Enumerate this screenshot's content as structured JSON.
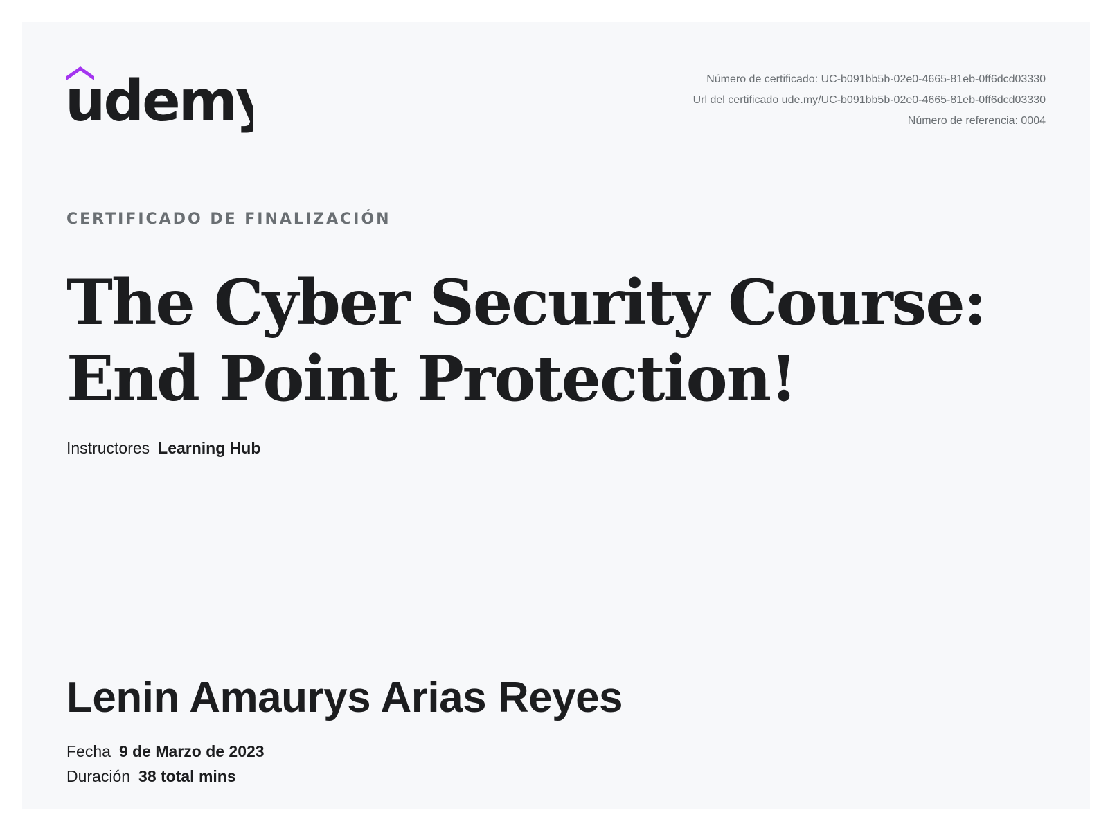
{
  "brand": {
    "name": "udemy",
    "accent_color": "#a435f0",
    "text_color": "#1c1d1f"
  },
  "certificate_meta": {
    "number": "Número de certificado: UC-b091bb5b-02e0-4665-81eb-0ff6dcd03330",
    "url": "Url del certificado ude.my/UC-b091bb5b-02e0-4665-81eb-0ff6dcd03330",
    "reference": "Número de referencia: 0004"
  },
  "eyebrow": "CERTIFICADO DE FINALIZACIÓN",
  "course_title": "The Cyber Security Course: End Point Protection!",
  "instructors": {
    "label": "Instructores",
    "value": "Learning Hub"
  },
  "student_name": "Lenin Amaurys Arias Reyes",
  "details": {
    "date": {
      "label": "Fecha",
      "value": "9 de Marzo de 2023"
    },
    "duration": {
      "label": "Duración",
      "value": "38 total mins"
    }
  }
}
